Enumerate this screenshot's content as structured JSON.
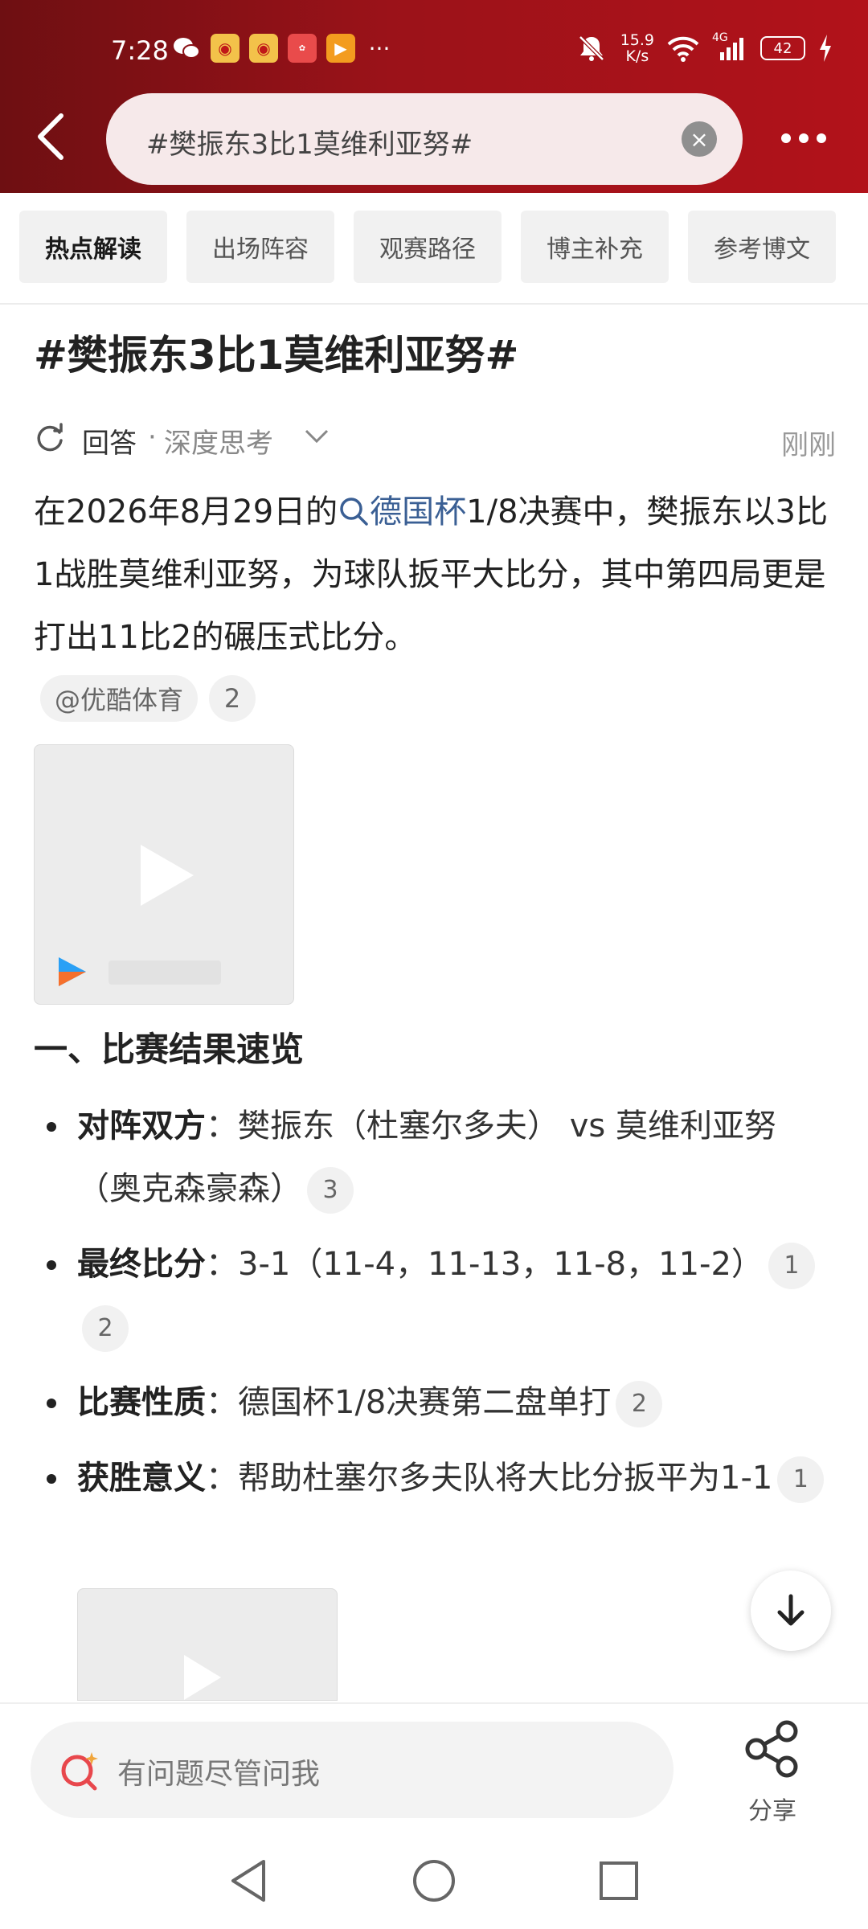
{
  "status_bar": {
    "time": "7:28",
    "net_speed_value": "15.9",
    "net_speed_unit": "K/s",
    "network": "4G",
    "battery": "42",
    "icons": [
      "wechat-icon",
      "weibo-icon",
      "weibo-icon",
      "huawei-icon",
      "app-icon",
      "more-notifications-icon",
      "mute-icon",
      "wifi-icon",
      "signal-icon",
      "battery-icon",
      "charging-icon"
    ]
  },
  "header": {
    "search_query": "#樊振东3比1莫维利亚努#",
    "colors": {
      "bg_start": "#6e0f12",
      "bg_end": "#b2121a",
      "search_bg": "#f6e9ea"
    }
  },
  "tabs": [
    {
      "label": "热点解读",
      "active": true
    },
    {
      "label": "出场阵容",
      "active": false
    },
    {
      "label": "观赛路径",
      "active": false
    },
    {
      "label": "博主补充",
      "active": false
    },
    {
      "label": "参考博文",
      "active": false
    }
  ],
  "content": {
    "title": "#樊振东3比1莫维利亚努#",
    "answer_label": "回答",
    "mode_separator": "·",
    "mode_label": "深度思考",
    "time": "刚刚",
    "para_before": "在2026年8月29日的",
    "para_link": "德国杯",
    "para_after": "1/8决赛中，樊振东以3比1战胜莫维利亚努，为球队扳平大比分，其中第四局更是打出11比2的碾压式比分。",
    "source_chip": "@优酷体育",
    "source_count": "2",
    "section_title": "一、比赛结果速览",
    "bullets": [
      {
        "label": "对阵双方",
        "sep": "：",
        "text": "樊振东（杜塞尔多夫） vs 莫维利亚努（奥克森豪森）",
        "cites": [
          "3"
        ]
      },
      {
        "label": "最终比分",
        "sep": "：",
        "text": "3-1（11-4，11-13，11-8，11-2）",
        "cites": [
          "1",
          "2"
        ]
      },
      {
        "label": "比赛性质",
        "sep": "：",
        "text": "德国杯1/8决赛第二盘单打",
        "cites": [
          "2"
        ]
      },
      {
        "label": "获胜意义",
        "sep": "：",
        "text": "帮助杜塞尔多夫队将大比分扳平为1-1",
        "cites": [
          "1"
        ]
      }
    ],
    "link_color": "#3a5f94"
  },
  "bottom_bar": {
    "ask_placeholder": "有问题尽管问我",
    "share_label": "分享"
  }
}
